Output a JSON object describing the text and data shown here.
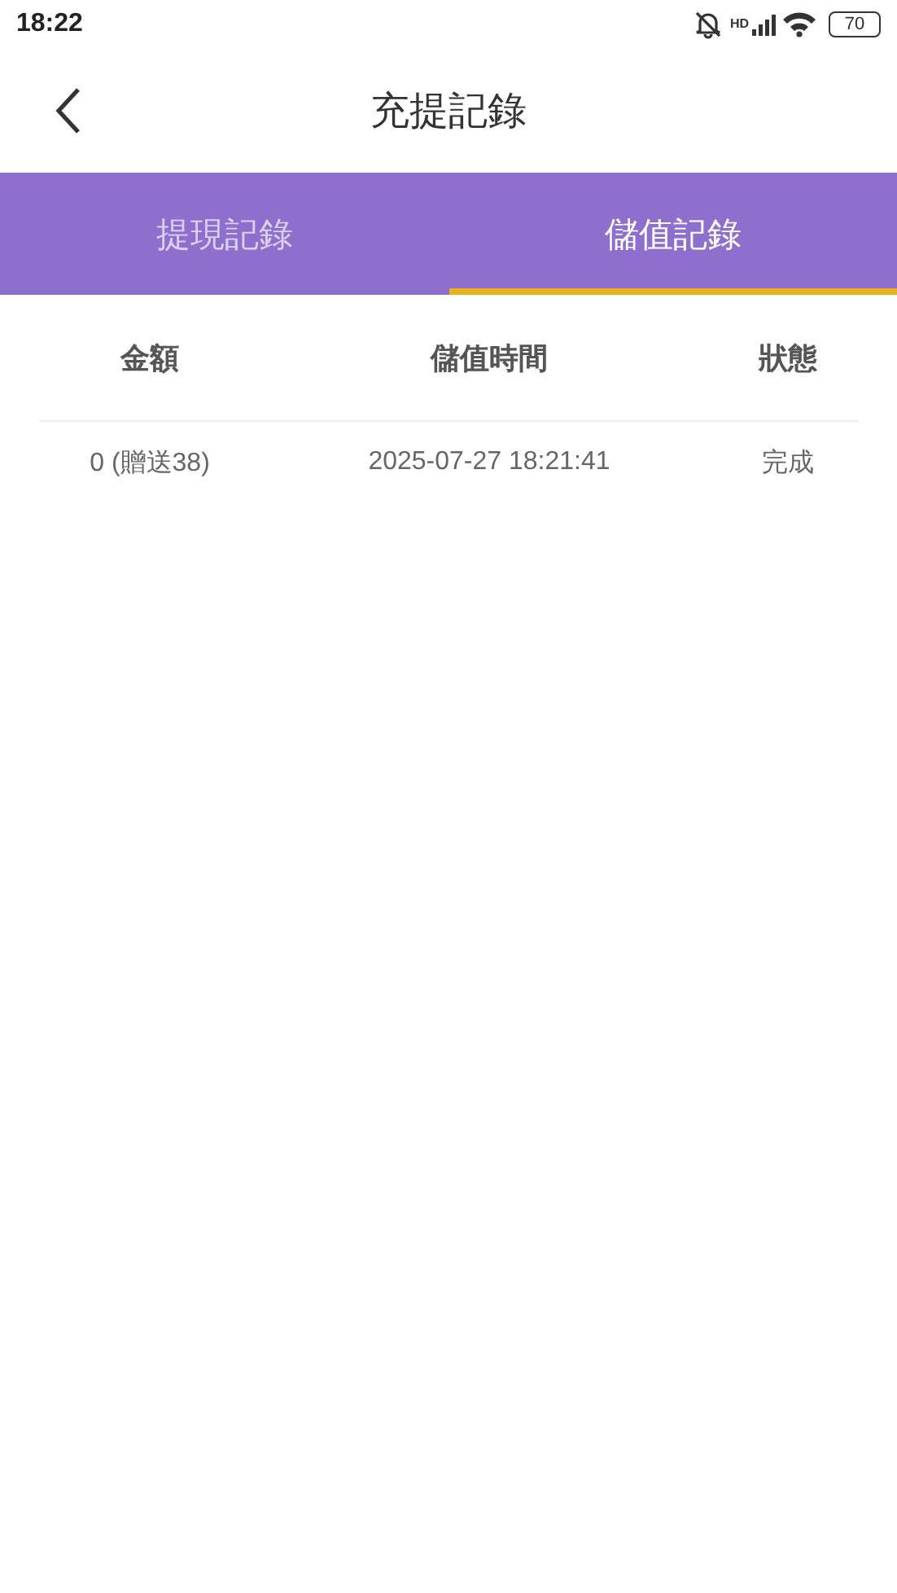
{
  "status_bar": {
    "time": "18:22",
    "network": "HD",
    "battery": "70"
  },
  "header": {
    "title": "充提記錄"
  },
  "tabs": [
    {
      "label": "提現記錄",
      "selected": false
    },
    {
      "label": "儲值記錄",
      "selected": true
    }
  ],
  "table": {
    "columns": [
      "金額",
      "儲值時間",
      "狀態"
    ],
    "rows": [
      [
        "0 (贈送38)",
        "2025-07-27 18:21:41",
        "完成"
      ]
    ]
  }
}
